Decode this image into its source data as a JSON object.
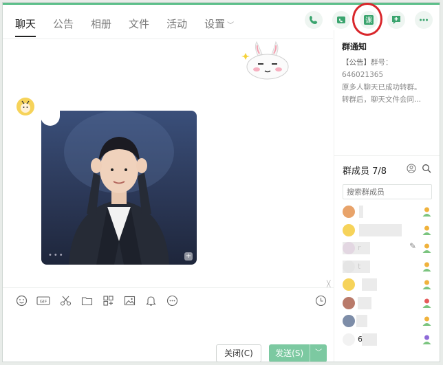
{
  "tabs": [
    {
      "label": "聊天",
      "active": true
    },
    {
      "label": "公告",
      "active": false
    },
    {
      "label": "相册",
      "active": false
    },
    {
      "label": "文件",
      "active": false
    },
    {
      "label": "活动",
      "active": false
    },
    {
      "label": "设置",
      "active": false,
      "dropdown": true
    }
  ],
  "actions": [
    {
      "icon": "phone-icon"
    },
    {
      "icon": "video-call-icon"
    },
    {
      "icon": "class-icon",
      "label": "课",
      "highlighted": true
    },
    {
      "icon": "add-app-icon"
    },
    {
      "icon": "more-icon"
    }
  ],
  "notice": {
    "title": "群通知",
    "tag": "【公告】",
    "line1_rest": "群号：",
    "line2": "646021365",
    "line3": "原多人聊天已成功转群。",
    "line4": "转群后，聊天文件会同..."
  },
  "members": {
    "heading": "群成员 7/8",
    "search_placeholder": "搜索群成员",
    "list": [
      {
        "name": "",
        "avatar_color": "#e8a36a",
        "role_color": "#f0b23c"
      },
      {
        "name": "",
        "avatar_color": "#f6d35a",
        "role_color": "#f0b23c"
      },
      {
        "name": "r",
        "avatar_color": "#c97cc0",
        "role_color": "#f0b23c"
      },
      {
        "name": "t",
        "avatar_color": "#d8d8d8",
        "role_color": "#f0b23c"
      },
      {
        "name": "",
        "avatar_color": "#f6d35a",
        "role_color": "#f0b23c"
      },
      {
        "name": "",
        "avatar_color": "#b97a6a",
        "role_color": "#e65b5b"
      },
      {
        "name": "",
        "avatar_color": "#7d8da8",
        "role_color": "#f0b23c"
      },
      {
        "name": "6",
        "avatar_color": "#f2f2f2",
        "role_color": "#8e6ad8"
      }
    ]
  },
  "buttons": {
    "close_label": "关闭(C)",
    "send_label": "发送(S)"
  },
  "colors": {
    "accent": "#5cbf8a",
    "send_button": "#7cc9a1",
    "highlight_circle": "#d9262b"
  }
}
